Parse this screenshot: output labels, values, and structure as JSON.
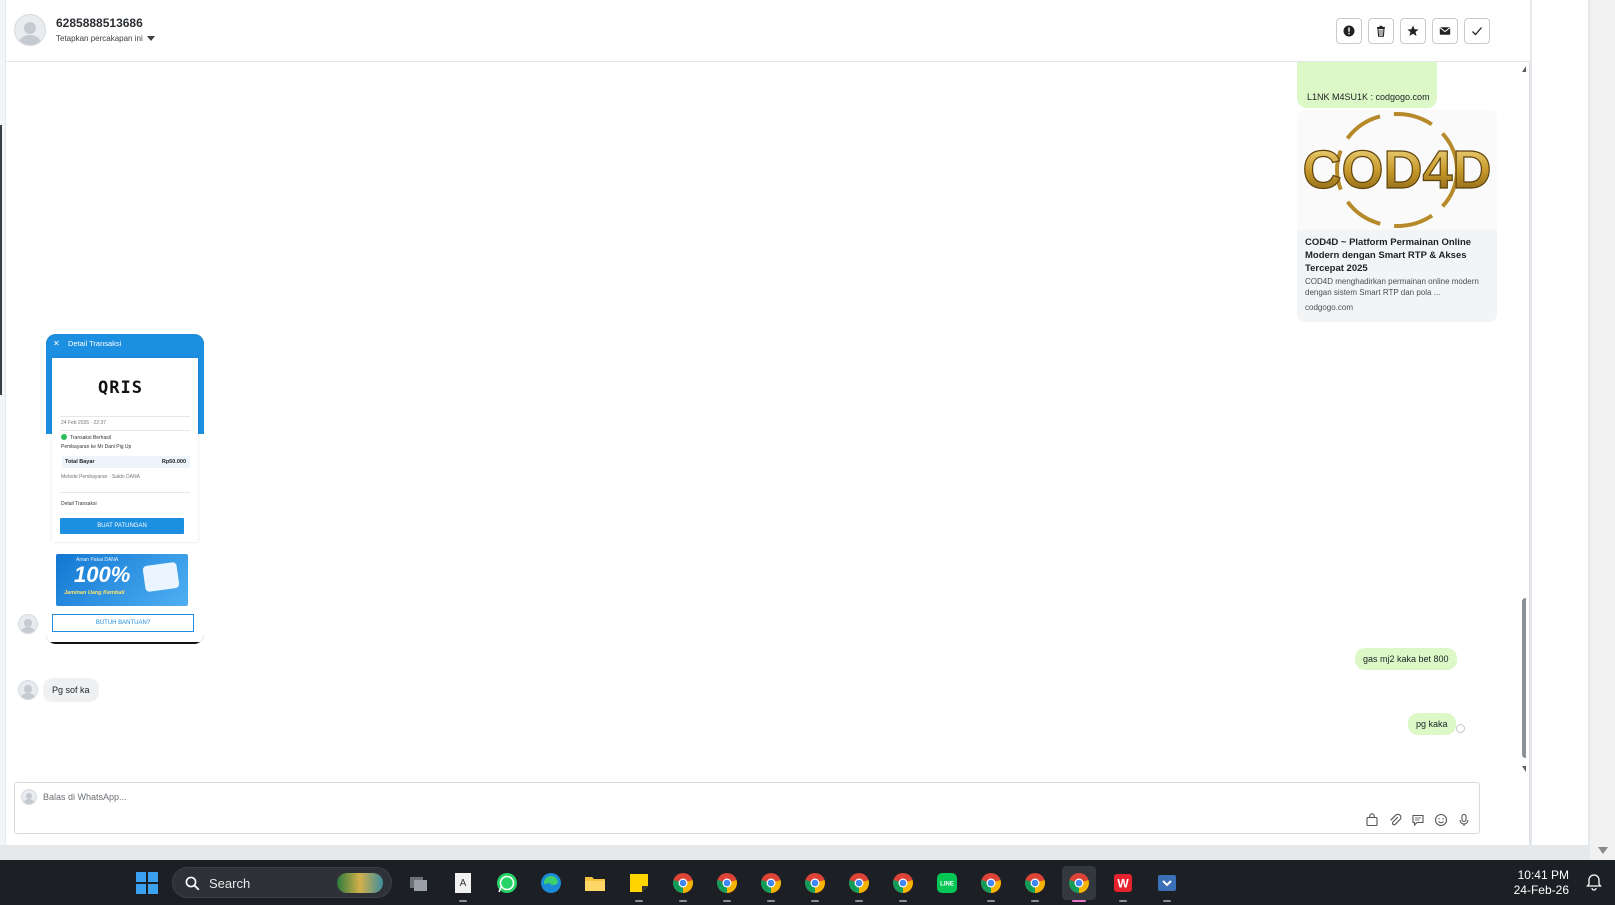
{
  "header": {
    "contact_name": "6285888513686",
    "assign_label": "Tetapkan percakapan ini",
    "actions": [
      "spam-icon",
      "trash-icon",
      "star-icon",
      "mail-icon",
      "check-icon"
    ]
  },
  "messages": {
    "link_text": "L1NK M4SU1K : codgogo.com",
    "preview": {
      "logo_text": "COD4D",
      "title": "COD4D ~ Platform Permainan Online Modern dengan Smart RTP & Akses Tercepat 2025",
      "description": "COD4D menghadirkan permainan online modern dengan sistem Smart RTP dan pola ...",
      "domain": "codgogo.com"
    },
    "image": {
      "header_title": "Detail Transaksi",
      "close_glyph": "✕",
      "qris_text": "QRIS",
      "payment_label": "Pembayaran ke Mr Dani Pig Up",
      "total_label": "Total Bayar",
      "total_value": "Rp50.000",
      "detail_label": "Detail Transaksi",
      "button_label": "BUAT PATUNGAN",
      "banner_top": "Aman Pakai DANA",
      "banner_big": "100%",
      "banner_sub": "Jaminan Uang Kembali",
      "help_label": "BUTUH BANTUAN?"
    },
    "incoming_text": "Pg sof ka",
    "outgoing_1": "gas mj2 kaka bet 800",
    "outgoing_2": "pg kaka"
  },
  "composer": {
    "placeholder": "Balas di WhatsApp...",
    "tools": [
      "bag-icon",
      "attach-icon",
      "chat-icon",
      "emoji-icon",
      "mic-icon"
    ]
  },
  "taskbar": {
    "search_label": "Search",
    "time": "10:41 PM",
    "date": "24-Feb-26",
    "apps": [
      "task-view-icon",
      "text-editor-icon",
      "whatsapp-icon",
      "edge-icon",
      "file-explorer-icon",
      "sticky-notes-icon",
      "chrome-icon",
      "chrome-icon",
      "chrome-icon",
      "chrome-icon",
      "chrome-icon",
      "chrome-icon",
      "line-icon",
      "chrome-icon",
      "chrome-icon",
      "chrome-icon",
      "wps-icon",
      "downloader-icon"
    ]
  },
  "colors": {
    "outgoing_bubble": "#dcf8c6",
    "incoming_bubble": "#eef0f2",
    "dana_blue": "#1d8fe0",
    "taskbar": "#1c1f24"
  }
}
